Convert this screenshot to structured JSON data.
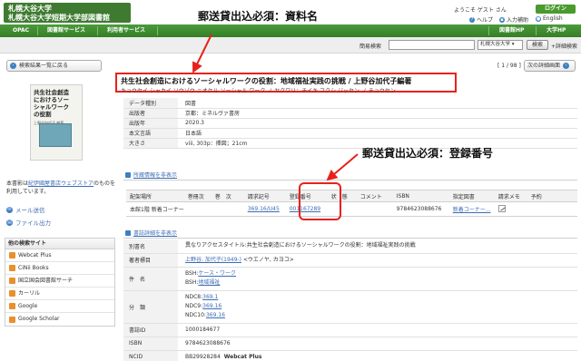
{
  "header": {
    "logo_line1": "札幌大谷大学",
    "logo_line2": "札幌大谷大学短期大学部図書館",
    "user_greeting": "ようこそ ゲスト さん",
    "login_label": "ログイン",
    "help_label": "ヘルプ",
    "input_help_label": "入力補助",
    "english_label": "English"
  },
  "annotations": {
    "title_required": "郵送貸出込必須：資料名",
    "regnum_required": "郵送貸出込必須：登録番号"
  },
  "nav": {
    "items": [
      "OPAC",
      "図書館サービス",
      "利用者サービス"
    ],
    "right_items": [
      "図書館HP",
      "大学HP"
    ]
  },
  "search": {
    "label": "簡易検索",
    "value": "",
    "scope": "札幌大谷大学",
    "button_label": "検索",
    "advanced_label": "+詳細検索"
  },
  "sidebar": {
    "back_label": "検索結果一覧に戻る",
    "cover": {
      "title_lines": [
        "共生社会創造",
        "におけるソー",
        "シャルワーク",
        "の役割"
      ],
      "subtitle": "上野谷加代子 編著"
    },
    "cover_note_prefix": "本書影は",
    "cover_note_link": "紀伊國屋書店ウェブストア",
    "cover_note_suffix": "のものを利用しています。",
    "mail_label": "メール送信",
    "file_label": "ファイル出力",
    "other_sites_title": "他の検索サイト",
    "other_sites": [
      "Webcat Plus",
      "CiNii Books",
      "国立国会図書館サーチ",
      "カーリル",
      "Google",
      "Google Scholar"
    ]
  },
  "record": {
    "page_count": "[ 1 / 98 ]",
    "next_label": "次の詳細画面",
    "title": "共生社会創造におけるソーシャルワークの役割：地域福祉実践の挑戦 / 上野谷加代子編著",
    "title_kana": "キョウセイ シャカイ ソウゾウ ニオケル ソーシャル ワーク ノ ヤクワリ：チイキ フクシ ジッセン ノ チョウセン",
    "fields": [
      {
        "key": "データ種別",
        "value": "図書"
      },
      {
        "key": "出版者",
        "value": "京都：ミネルヴァ書房"
      },
      {
        "key": "出版年",
        "value": "2020.3"
      },
      {
        "key": "本文言語",
        "value": "日本語"
      },
      {
        "key": "大きさ",
        "value": "viii, 303p：挿図；21cm"
      }
    ]
  },
  "holdings": {
    "section_title": "所蔵情報を非表示",
    "headers": [
      "配架場所",
      "巻冊次",
      "巻　次",
      "請求記号",
      "登録番号",
      "状　態",
      "コメント",
      "ISBN",
      "指定図書",
      "請求メモ",
      "予約"
    ],
    "row": {
      "location": "本館1階 新着コーナー",
      "call_number": "369.16/U45",
      "reg_number": "001167289",
      "isbn": "9784623088676",
      "designated": "新着コーナー..."
    }
  },
  "details": {
    "section_title": "書誌詳細を非表示",
    "alt_title_key": "別書名",
    "alt_title": "異なりアクセスタイトル:共生社会創造におけるソーシャルワークの役割：地域福祉実践の挑戦",
    "author_key": "著者標目",
    "author_link": "上野谷, 加代子(1949-)",
    "author_rest": "<ウエノヤ, カヨコ>",
    "subject_key": "件　名",
    "subject1_prefix": "BSH:",
    "subject1": "ケース・ワーク",
    "subject2_prefix": "BSH:",
    "subject2": "地域福祉",
    "class_key": "分　類",
    "class1_prefix": "NDC8:",
    "class1": "369.1",
    "class2_prefix": "NDC9:",
    "class2": "369.16",
    "class3_prefix": "NDC10:",
    "class3": "369.16",
    "bibid_key": "書誌ID",
    "bibid": "1000184677",
    "isbn_key": "ISBN",
    "isbn": "9784623088676",
    "ncid_key": "NCID",
    "ncid": "BB29928284",
    "ncid_link": "Webcat Plus"
  },
  "colors": {
    "brand_green": "#3e7b31",
    "annotation_red": "#e8211c",
    "link_blue": "#3d6db5"
  }
}
